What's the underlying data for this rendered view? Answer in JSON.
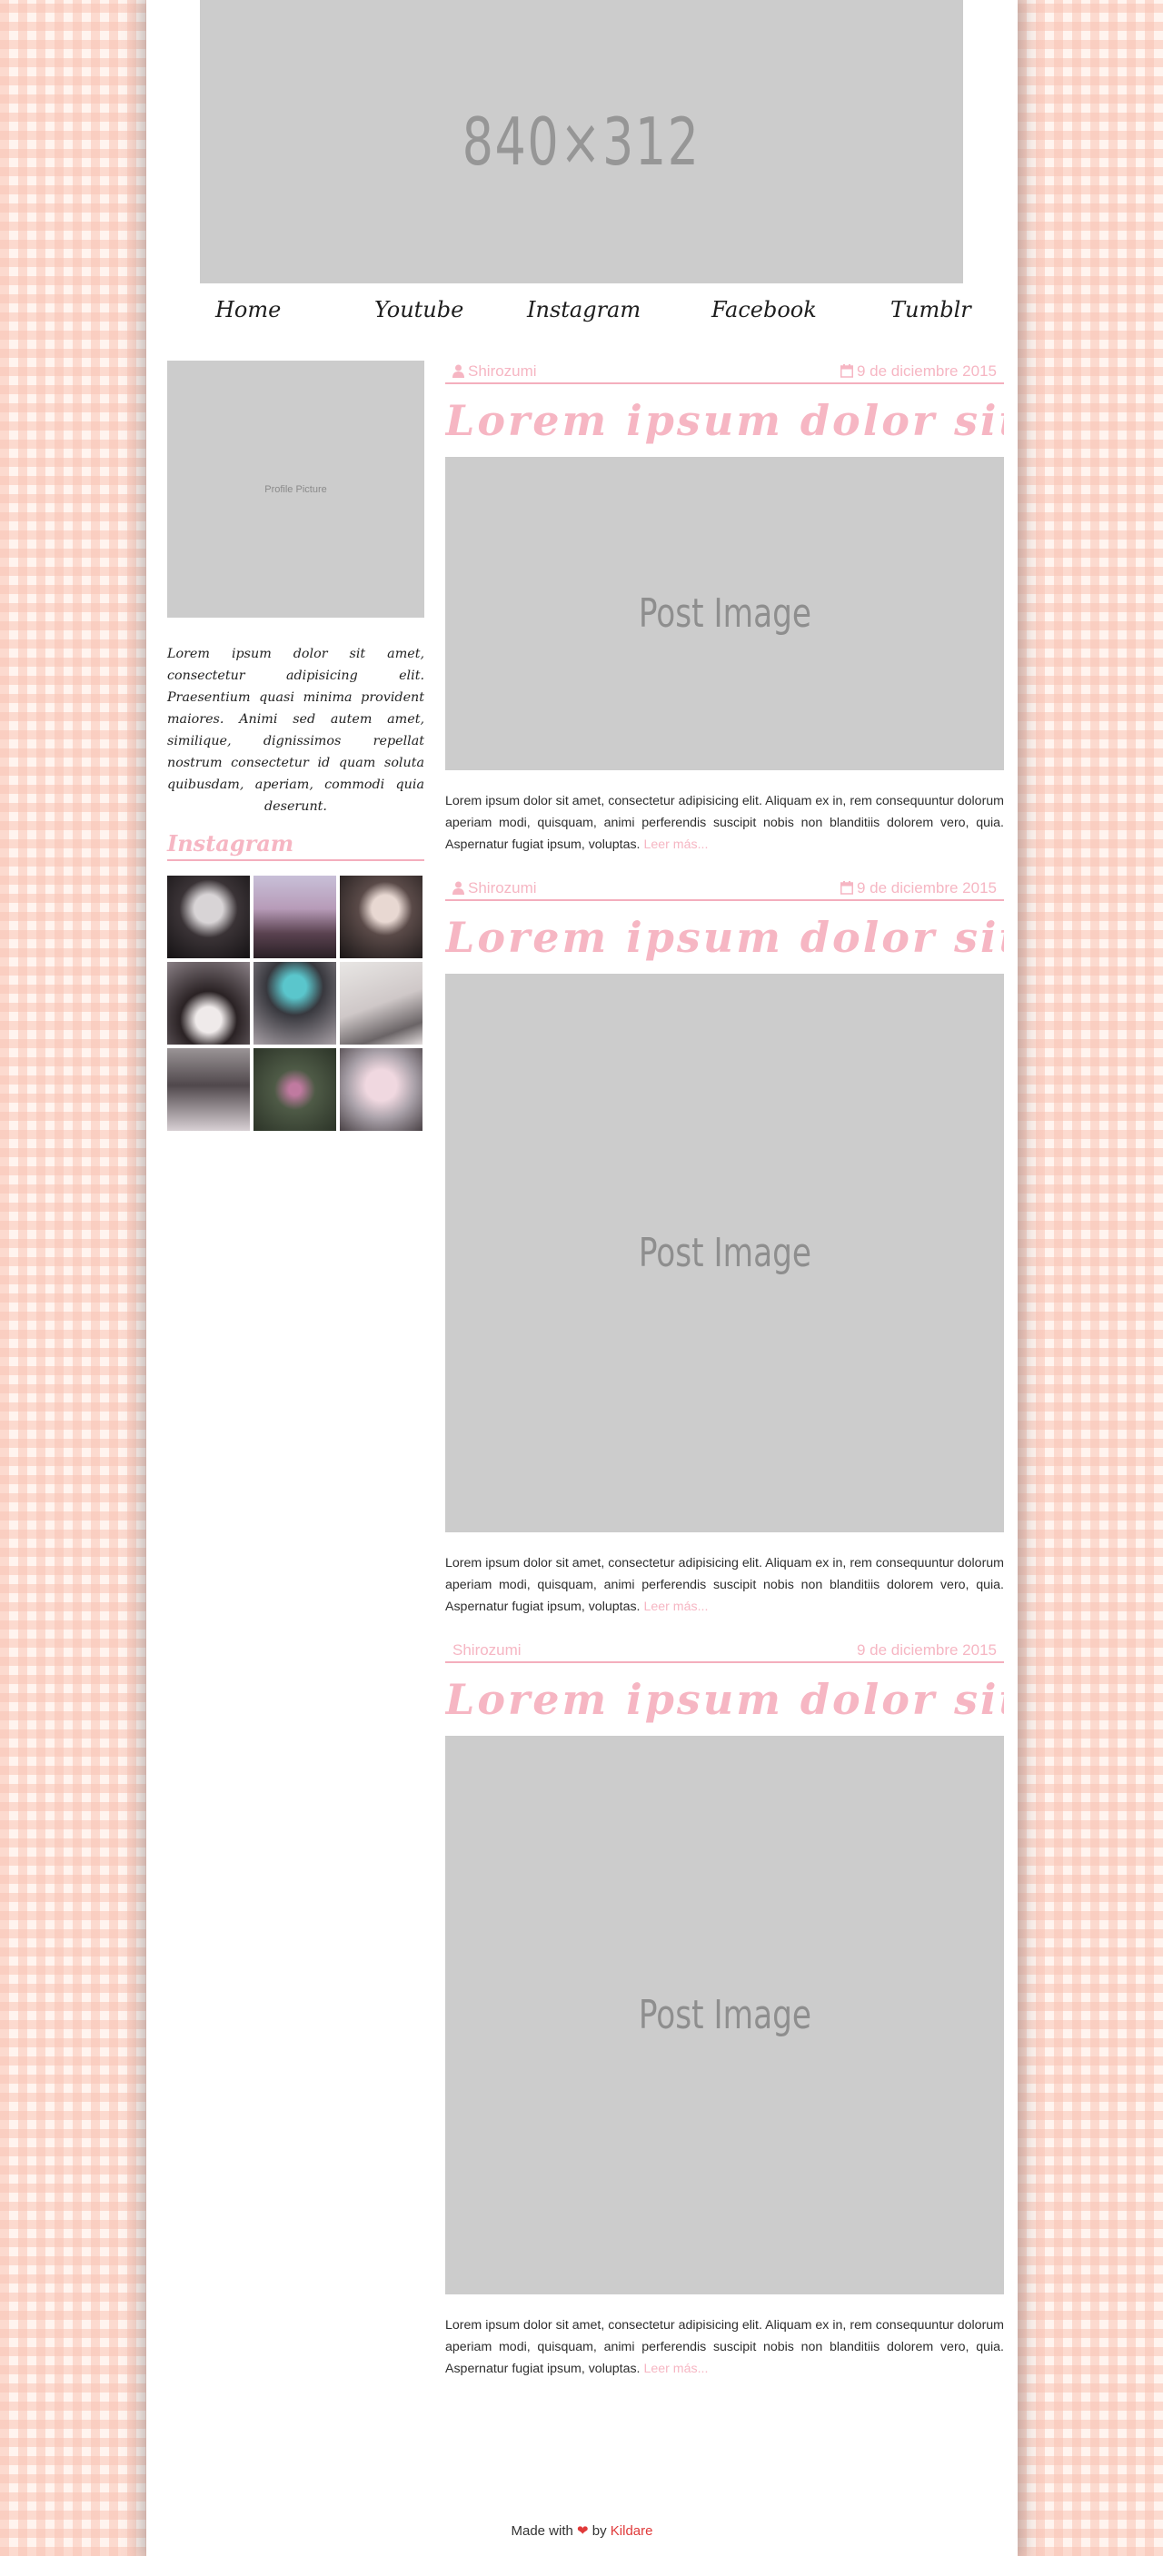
{
  "banner": {
    "placeholder": "840×312"
  },
  "nav": [
    "Home",
    "Youtube",
    "Instagram",
    "Facebook",
    "Tumblr"
  ],
  "sidebar": {
    "profile_placeholder": "Profile Picture",
    "bio": "Lorem ipsum dolor sit amet, consectetur adipisicing elit. Praesentium quasi minima provident maiores. Animi sed autem amet, similique, dignissimos repellat nostrum consectetur id quam soluta quibusdam, aperiam, commodi quia deserunt.",
    "instagram_title": "Instagram",
    "instagram_photos": [
      {
        "icon": "photo-1"
      },
      {
        "icon": "photo-2"
      },
      {
        "icon": "photo-3"
      },
      {
        "icon": "photo-4"
      },
      {
        "icon": "photo-5"
      },
      {
        "icon": "photo-6"
      },
      {
        "icon": "photo-7"
      },
      {
        "icon": "photo-8"
      },
      {
        "icon": "photo-9"
      }
    ]
  },
  "posts": [
    {
      "author": "Shirozumi",
      "date": "9 de diciembre 2015",
      "title": "Lorem ipsum dolor sit amet",
      "image_placeholder": "Post Image",
      "text": "Lorem ipsum dolor sit amet, consectetur adipisicing elit. Aliquam ex in, rem consequuntur dolorum aperiam modi, quisquam, animi perferendis suscipit nobis non blanditiis dolorem vero, quia. Aspernatur fugiat ipsum, voluptas.",
      "more": "Leer más..."
    },
    {
      "author": "Shirozumi",
      "date": "9 de diciembre 2015",
      "title": "Lorem ipsum dolor sit amet",
      "image_placeholder": "Post Image",
      "text": "Lorem ipsum dolor sit amet, consectetur adipisicing elit. Aliquam ex in, rem consequuntur dolorum aperiam modi, quisquam, animi perferendis suscipit nobis non blanditiis dolorem vero, quia. Aspernatur fugiat ipsum, voluptas.",
      "more": "Leer más..."
    },
    {
      "author": "Shirozumi",
      "date": "9 de diciembre 2015",
      "title": "Lorem ipsum dolor sit amet",
      "image_placeholder": "Post Image",
      "text": "Lorem ipsum dolor sit amet, consectetur adipisicing elit. Aliquam ex in, rem consequuntur dolorum aperiam modi, quisquam, animi perferendis suscipit nobis non blanditiis dolorem vero, quia. Aspernatur fugiat ipsum, voluptas.",
      "more": "Leer más..."
    }
  ],
  "footer": {
    "prefix": "Made with",
    "heart": "❤",
    "by": "by",
    "author": "Kildare"
  },
  "colors": {
    "accent_pink": "#f6b6c3",
    "placeholder_gray": "#cccccc",
    "heart_red": "#e03a3a"
  }
}
